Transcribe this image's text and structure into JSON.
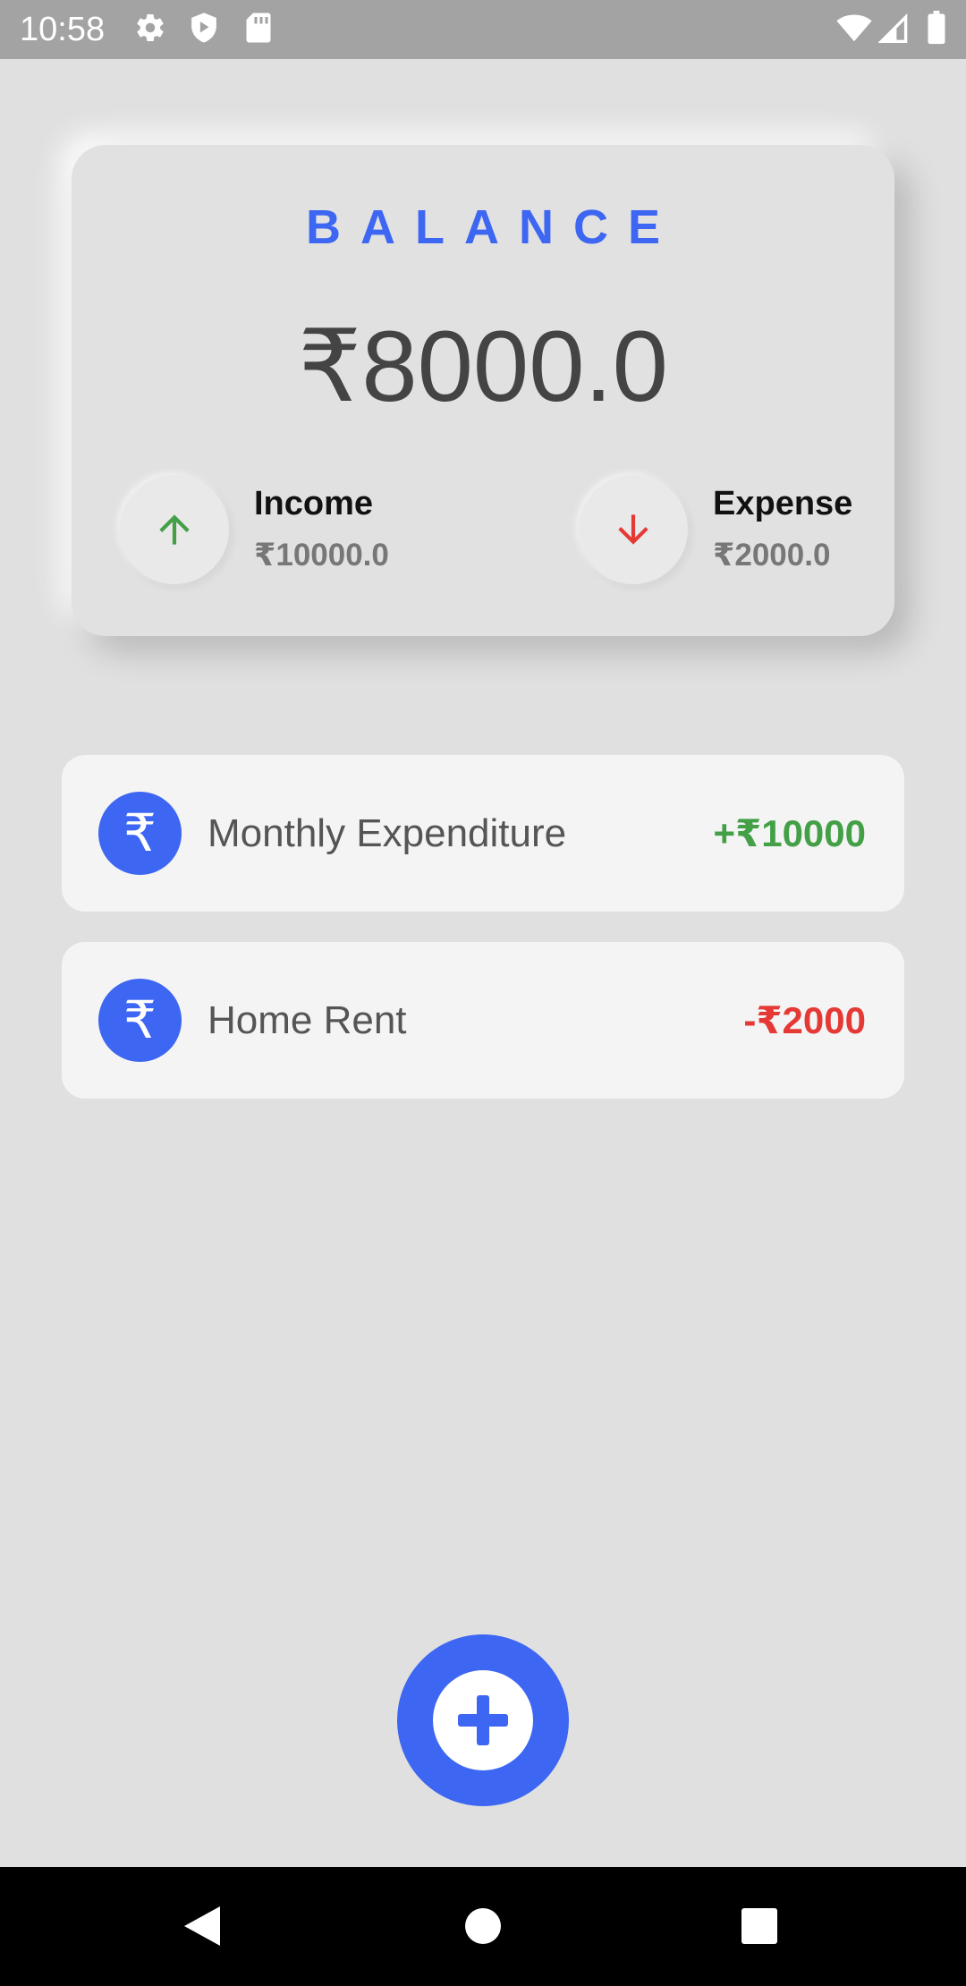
{
  "status_bar": {
    "time": "10:58",
    "left_icons": [
      "gear-icon",
      "shield-icon",
      "sd-card-icon"
    ],
    "right_icons": [
      "wifi-icon",
      "cell-signal-icon",
      "battery-icon"
    ]
  },
  "balance": {
    "title": "BALANCE",
    "amount": "₹8000.0",
    "income": {
      "label": "Income",
      "value": "₹10000.0",
      "icon": "arrow-up-icon",
      "color": "#43a047"
    },
    "expense": {
      "label": "Expense",
      "value": "₹2000.0",
      "icon": "arrow-down-icon",
      "color": "#e53935"
    }
  },
  "transactions": [
    {
      "name": "Monthly Expenditure",
      "amount": "+₹10000",
      "icon_glyph": "₹",
      "icon": "rupee-icon",
      "color": "#43a047"
    },
    {
      "name": "Home Rent",
      "amount": "-₹2000",
      "icon_glyph": "₹",
      "icon": "rupee-icon",
      "color": "#e53935"
    }
  ],
  "fab": {
    "icon": "plus-icon"
  },
  "nav_bar": {
    "buttons": [
      "back-icon",
      "home-icon",
      "recents-icon"
    ]
  },
  "colors": {
    "accent": "#3d66f2",
    "background": "#e0e0e0",
    "income": "#43a047",
    "expense": "#e53935"
  }
}
